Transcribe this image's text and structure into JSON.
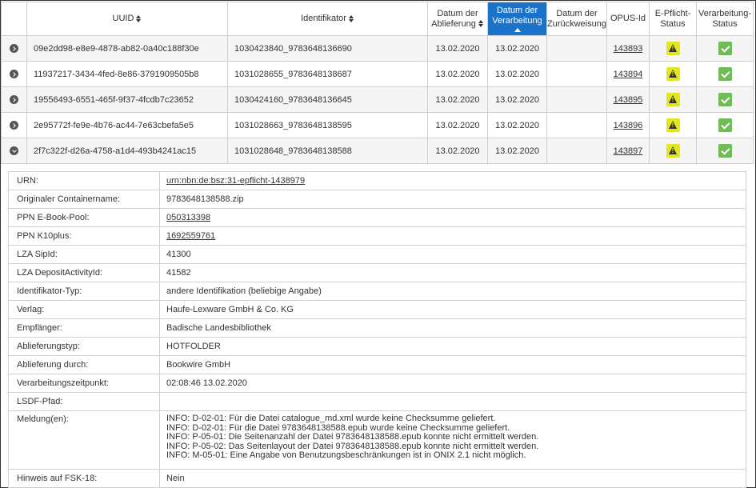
{
  "columns": {
    "uuid": "UUID",
    "identifikator": "Identifikator",
    "datum_ablieferung": [
      "Datum der",
      "Ablieferung"
    ],
    "datum_verarbeitung": [
      "Datum der",
      "Verarbeitung"
    ],
    "datum_zurueckweisung": [
      "Datum der",
      "Zurückweisung"
    ],
    "opus_id": "OPUS-Id",
    "epflicht_status": [
      "E-Pflicht-",
      "Status"
    ],
    "verarbeitung_status": [
      "Verarbeitung-",
      "Status"
    ]
  },
  "rows": [
    {
      "uuid": "09e2dd98-e8e9-4878-ab82-0a40c188f30e",
      "identifikator": "1030423840_9783648136690",
      "ablieferung": "13.02.2020",
      "verarbeitung": "13.02.2020",
      "zurueckweisung": "",
      "opus_id": "143893",
      "expanded": false
    },
    {
      "uuid": "11937217-3434-4fed-8e86-3791909505b8",
      "identifikator": "1031028655_9783648138687",
      "ablieferung": "13.02.2020",
      "verarbeitung": "13.02.2020",
      "zurueckweisung": "",
      "opus_id": "143894",
      "expanded": false
    },
    {
      "uuid": "19556493-6551-465f-9f37-4fcdb7c23652",
      "identifikator": "1030424160_9783648136645",
      "ablieferung": "13.02.2020",
      "verarbeitung": "13.02.2020",
      "zurueckweisung": "",
      "opus_id": "143895",
      "expanded": false
    },
    {
      "uuid": "2e95772f-fe9e-4b76-ac44-7e63cbefa5e5",
      "identifikator": "1031028663_9783648138595",
      "ablieferung": "13.02.2020",
      "verarbeitung": "13.02.2020",
      "zurueckweisung": "",
      "opus_id": "143896",
      "expanded": false
    },
    {
      "uuid": "2f7c322f-d26a-4758-a1d4-493b4241ac15",
      "identifikator": "1031028648_9783648138588",
      "ablieferung": "13.02.2020",
      "verarbeitung": "13.02.2020",
      "zurueckweisung": "",
      "opus_id": "143897",
      "expanded": true
    }
  ],
  "icons": {
    "expand": "chevron-right-icon",
    "collapse": "chevron-down-icon",
    "warning": "warning-icon",
    "ok": "check-icon",
    "sort": "sort-icon",
    "sort_asc": "sort-ascending-icon"
  },
  "colors": {
    "active_header": "#1a73c9",
    "warning": "#e4e421",
    "ok": "#6fbb58"
  },
  "details": [
    {
      "label": "URN:",
      "value": "urn:nbn:de:bsz:31-epflicht-1438979",
      "link": true
    },
    {
      "label": "Originaler Containername:",
      "value": "9783648138588.zip",
      "link": false
    },
    {
      "label": "PPN E-Book-Pool:",
      "value": "050313398",
      "link": true
    },
    {
      "label": "PPN K10plus:",
      "value": "1692559761",
      "link": true
    },
    {
      "label": "LZA SipId:",
      "value": "41300",
      "link": false
    },
    {
      "label": "LZA DepositActivityId:",
      "value": "41582",
      "link": false
    },
    {
      "label": "Identifikator-Typ:",
      "value": "andere Identifikation (beliebige Angabe)",
      "link": false
    },
    {
      "label": "Verlag:",
      "value": "Haufe-Lexware GmbH & Co. KG",
      "link": false
    },
    {
      "label": "Empfänger:",
      "value": "Badische Landesbibliothek",
      "link": false
    },
    {
      "label": "Ablieferungstyp:",
      "value": "HOTFOLDER",
      "link": false
    },
    {
      "label": "Ablieferung durch:",
      "value": "Bookwire GmbH",
      "link": false
    },
    {
      "label": "Verarbeitungszeitpunkt:",
      "value": "02:08:46 13.02.2020",
      "link": false
    },
    {
      "label": "LSDF-Pfad:",
      "value": "",
      "link": false
    }
  ],
  "meldungen": {
    "label": "Meldung(en):",
    "lines": [
      "INFO: D-02-01: Für die Datei catalogue_md.xml wurde keine Checksumme geliefert.",
      "INFO: D-02-01: Für die Datei 9783648138588.epub wurde keine Checksumme geliefert.",
      "INFO: P-05-01: Die Seitenanzahl der Datei 9783648138588.epub konnte nicht ermittelt werden.",
      "INFO: P-05-02: Das Seitenlayout der Datei 9783648138588.epub konnte nicht ermittelt werden.",
      "INFO: M-05-01: Eine Angabe von Benutzungsbeschränkungen ist in ONIX 2.1 nicht möglich."
    ]
  },
  "fsk": {
    "label": "Hinweis auf FSK-18:",
    "value": "Nein"
  }
}
